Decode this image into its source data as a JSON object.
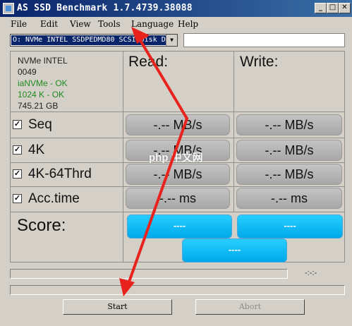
{
  "window": {
    "title": "AS SSD Benchmark 1.7.4739.38088",
    "minimize": "_",
    "maximize": "□",
    "close": "✕"
  },
  "menu": [
    "File",
    "Edit",
    "View",
    "Tools",
    "Language",
    "Help"
  ],
  "drive_select": {
    "value": "O: NVMe INTEL SSDPEDMD80 SCSI Disk D",
    "arrow": "▼"
  },
  "drive_info": {
    "lines": [
      "NVMe INTEL",
      "0049",
      "iaNVMe - OK",
      "1024 K - OK",
      "745.21 GB"
    ]
  },
  "columns": {
    "read": "Read:",
    "write": "Write:"
  },
  "tests": [
    {
      "label": "Seq",
      "checked": "✓",
      "read": "-.-- MB/s",
      "write": "-.-- MB/s"
    },
    {
      "label": "4K",
      "checked": "✓",
      "read": "-.-- MB/s",
      "write": "-.-- MB/s"
    },
    {
      "label": "4K-64Thrd",
      "checked": "✓",
      "read": "-.-- MB/s",
      "write": "-.-- MB/s"
    },
    {
      "label": "Acc.time",
      "checked": "✓",
      "read": "-.-- ms",
      "write": "-.-- ms"
    }
  ],
  "score": {
    "label": "Score:",
    "read": "----",
    "write": "----",
    "total": "----"
  },
  "elapsed": "-:-:-",
  "buttons": {
    "start": "Start",
    "abort": "Abort"
  },
  "watermark": "php 中文网",
  "colors": {
    "titlebar_start": "#0a246a",
    "titlebar_end": "#3a6ea5",
    "score_blue": "#00bfff",
    "annotation_red": "#e8231d",
    "ok_green": "#1f8a1f"
  }
}
